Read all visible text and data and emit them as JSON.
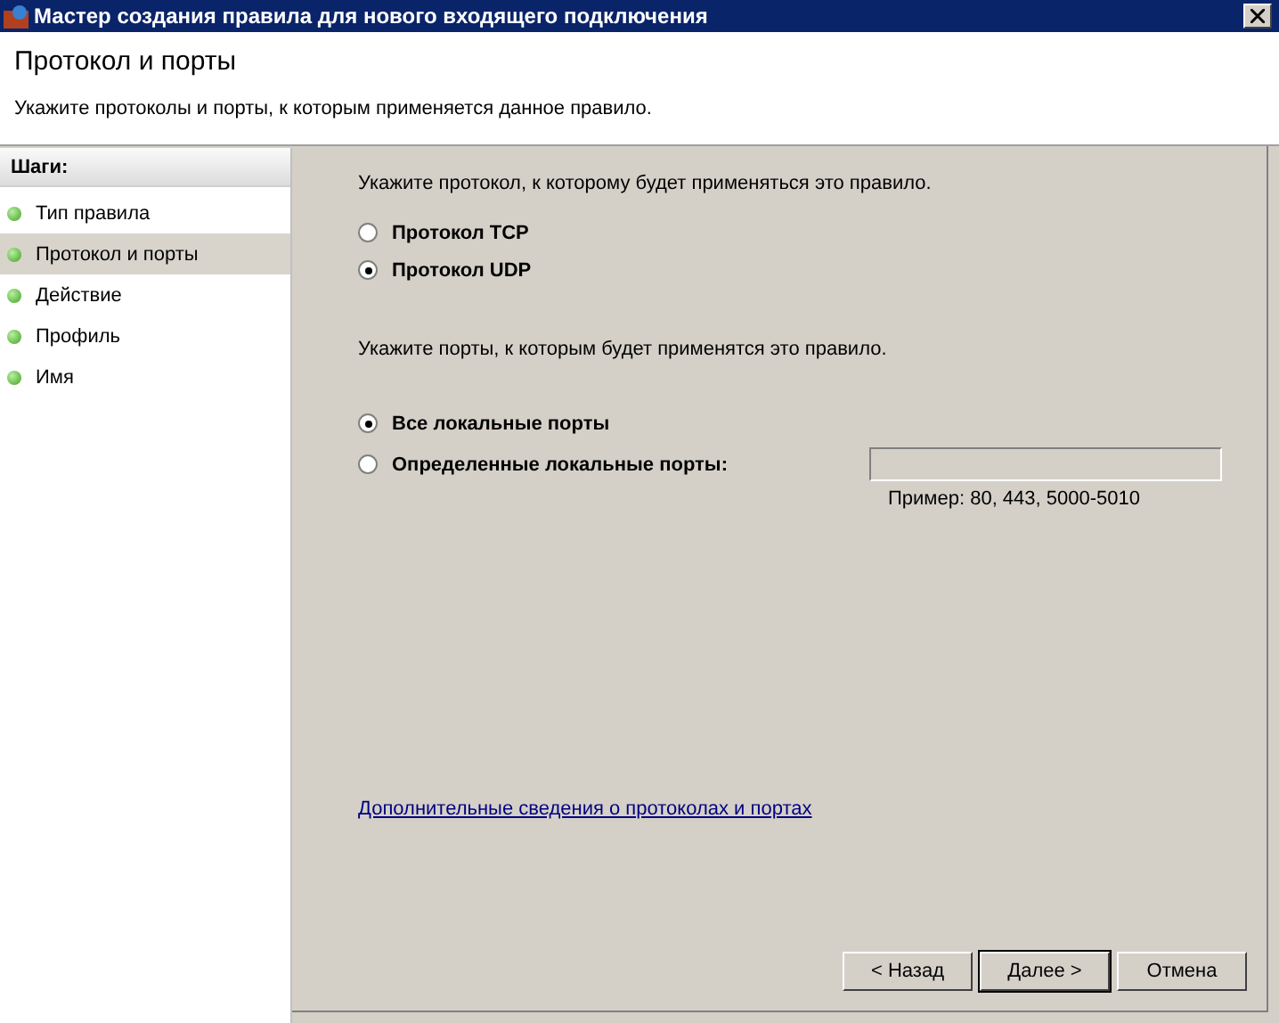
{
  "window": {
    "title": "Мастер создания правила для нового входящего подключения"
  },
  "header": {
    "title": "Протокол и порты",
    "subtitle": "Укажите протоколы и порты, к которым применяется данное правило."
  },
  "steps": {
    "title": "Шаги:",
    "items": [
      {
        "label": "Тип правила",
        "selected": false
      },
      {
        "label": "Протокол и порты",
        "selected": true
      },
      {
        "label": "Действие",
        "selected": false
      },
      {
        "label": "Профиль",
        "selected": false
      },
      {
        "label": "Имя",
        "selected": false
      }
    ]
  },
  "protocol": {
    "prompt": "Укажите протокол, к которому будет применяться это правило.",
    "options": [
      {
        "label": "Протокол TCP",
        "selected": false
      },
      {
        "label": "Протокол UDP",
        "selected": true
      }
    ]
  },
  "ports": {
    "prompt": "Укажите порты, к которым будет применятся это правило.",
    "options": [
      {
        "label": "Все локальные порты",
        "selected": true
      },
      {
        "label": "Определенные локальные порты:",
        "selected": false
      }
    ],
    "field": {
      "disabled": true
    },
    "example": "Пример: 80, 443, 5000-5010"
  },
  "link": "Дополнительные сведения о протоколах и портах",
  "buttons": [
    {
      "label": "< Назад",
      "default": false
    },
    {
      "label": "Далее >",
      "default": true
    },
    {
      "label": "Отмена",
      "default": false
    }
  ]
}
